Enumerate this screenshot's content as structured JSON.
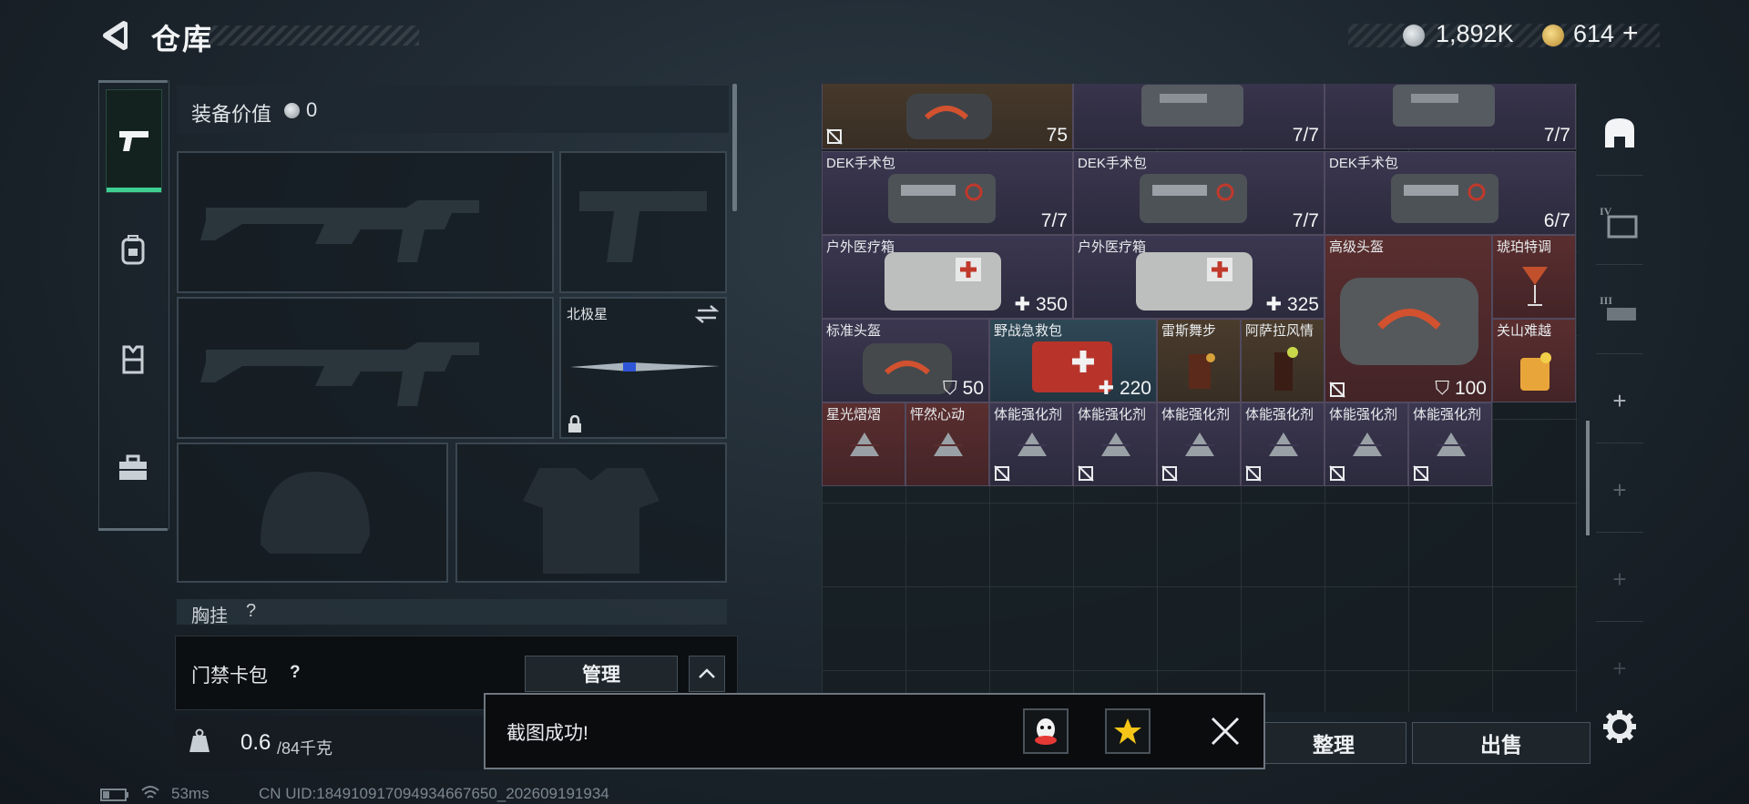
{
  "header": {
    "title": "仓库",
    "currency_silver": "1,892K",
    "currency_gold": "614",
    "currency_add": "+"
  },
  "left_tabs": [
    {
      "name": "firearms",
      "icon": "pistol-icon",
      "active": true
    },
    {
      "name": "backpack",
      "icon": "backpack-icon",
      "active": false
    },
    {
      "name": "vest",
      "icon": "vest-icon",
      "active": false
    },
    {
      "name": "case",
      "icon": "briefcase-icon",
      "active": false
    }
  ],
  "equipment": {
    "value_label": "装备价值",
    "value": "0",
    "melee_name": "北极星",
    "chest_rig_label": "胸挂",
    "chest_rig_help": "?"
  },
  "keycard": {
    "label": "门禁卡包",
    "help": "?",
    "manage": "管理"
  },
  "weight": {
    "current": "0.6",
    "max": "/84千克"
  },
  "inventory": {
    "row0": [
      {
        "name": "",
        "val": "75",
        "kind": "armor"
      },
      {
        "name": "",
        "val": "7/7",
        "kind": "count"
      },
      {
        "name": "",
        "val": "7/7",
        "kind": "count"
      }
    ],
    "row1": [
      {
        "name": "DEK手术包",
        "val": "7/7"
      },
      {
        "name": "DEK手术包",
        "val": "7/7"
      },
      {
        "name": "DEK手术包",
        "val": "6/7"
      }
    ],
    "row2": [
      {
        "name": "户外医疗箱",
        "val": "350"
      },
      {
        "name": "户外医疗箱",
        "val": "325"
      },
      {
        "name": "高级头盔",
        "val": "100"
      },
      {
        "name": "琥珀特调",
        "val": ""
      }
    ],
    "row3": [
      {
        "name": "标准头盔",
        "val": "50"
      },
      {
        "name": "野战急救包",
        "val": "220"
      },
      {
        "name": "雷斯舞步",
        "val": ""
      },
      {
        "name": "阿萨拉风情",
        "val": ""
      },
      {
        "name": "关山难越",
        "val": ""
      }
    ],
    "row4": [
      {
        "name": "星光熠熠"
      },
      {
        "name": "怦然心动"
      },
      {
        "name": "体能强化剂"
      },
      {
        "name": "体能强化剂"
      },
      {
        "name": "体能强化剂"
      },
      {
        "name": "体能强化剂"
      },
      {
        "name": "体能强化剂"
      },
      {
        "name": "体能强化剂"
      }
    ]
  },
  "right_tabs": [
    {
      "icon": "warehouse-icon"
    },
    {
      "icon": "stash-iv-icon",
      "label": "IV"
    },
    {
      "icon": "stash-iii-icon",
      "label": "III"
    },
    {
      "icon": "add-icon"
    },
    {
      "icon": "add-icon"
    },
    {
      "icon": "add-icon"
    },
    {
      "icon": "add-icon"
    }
  ],
  "actions": {
    "sort": "整理",
    "sell": "出售"
  },
  "toast": {
    "message": "截图成功!"
  },
  "status_bar": {
    "ping": "53ms",
    "uid": "CN UID:184910917094934667650_202609191934"
  },
  "colors": {
    "accent": "#3ecf93",
    "rarity_purple": "#3b3750",
    "rarity_red": "#5a2e2f",
    "rarity_brown": "#4a3c2d"
  }
}
